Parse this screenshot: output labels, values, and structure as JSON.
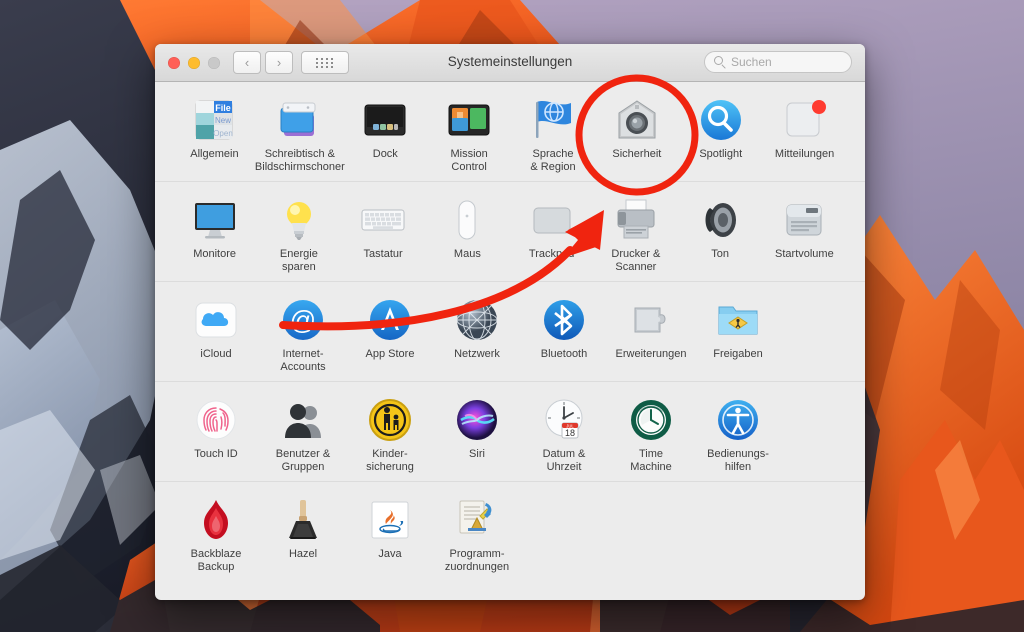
{
  "window": {
    "title": "Systemeinstellungen",
    "traffic_lights": [
      {
        "name": "close",
        "color": "#ff5f57"
      },
      {
        "name": "minimize",
        "color": "#febc2e"
      },
      {
        "name": "zoom",
        "color": "#c9c9c9"
      }
    ],
    "nav": {
      "back": "‹",
      "forward": "›",
      "grid": "show-all-grid"
    },
    "search": {
      "placeholder": "Suchen",
      "value": ""
    }
  },
  "annotation": {
    "color": "#f0240f",
    "circle_target": "Sicherheit",
    "arrow_from": "Internet-Accounts",
    "arrow_to": "Sicherheit"
  },
  "rows": [
    {
      "items": [
        {
          "label": "Allgemein",
          "icon": "general-icon"
        },
        {
          "label": "Schreibtisch &\nBildschirmschoner",
          "icon": "desktop-screensaver-icon"
        },
        {
          "label": "Dock",
          "icon": "dock-icon"
        },
        {
          "label": "Mission\nControl",
          "icon": "mission-control-icon"
        },
        {
          "label": "Sprache\n& Region",
          "icon": "language-region-icon"
        },
        {
          "label": "Sicherheit",
          "icon": "security-icon"
        },
        {
          "label": "Spotlight",
          "icon": "spotlight-icon"
        },
        {
          "label": "Mitteilungen",
          "icon": "notifications-icon"
        }
      ]
    },
    {
      "items": [
        {
          "label": "Monitore",
          "icon": "displays-icon"
        },
        {
          "label": "Energie\nsparen",
          "icon": "energy-saver-icon"
        },
        {
          "label": "Tastatur",
          "icon": "keyboard-icon"
        },
        {
          "label": "Maus",
          "icon": "mouse-icon"
        },
        {
          "label": "Trackpad",
          "icon": "trackpad-icon"
        },
        {
          "label": "Drucker &\nScanner",
          "icon": "printers-scanners-icon"
        },
        {
          "label": "Ton",
          "icon": "sound-icon"
        },
        {
          "label": "Startvolume",
          "icon": "startup-disk-icon"
        }
      ]
    },
    {
      "items": [
        {
          "label": "iCloud",
          "icon": "icloud-icon"
        },
        {
          "label": "Internet-\nAccounts",
          "icon": "internet-accounts-icon"
        },
        {
          "label": "App Store",
          "icon": "app-store-icon"
        },
        {
          "label": "Netzwerk",
          "icon": "network-icon"
        },
        {
          "label": "Bluetooth",
          "icon": "bluetooth-icon"
        },
        {
          "label": "Erweiterungen",
          "icon": "extensions-icon"
        },
        {
          "label": "Freigaben",
          "icon": "sharing-icon"
        }
      ]
    },
    {
      "items": [
        {
          "label": "Touch ID",
          "icon": "touch-id-icon"
        },
        {
          "label": "Benutzer &\nGruppen",
          "icon": "users-groups-icon"
        },
        {
          "label": "Kinder-\nsicherung",
          "icon": "parental-controls-icon"
        },
        {
          "label": "Siri",
          "icon": "siri-icon"
        },
        {
          "label": "Datum &\nUhrzeit",
          "icon": "date-time-icon"
        },
        {
          "label": "Time\nMachine",
          "icon": "time-machine-icon"
        },
        {
          "label": "Bedienungs-\nhilfen",
          "icon": "accessibility-icon"
        }
      ]
    },
    {
      "items": [
        {
          "label": "Backblaze\nBackup",
          "icon": "backblaze-icon"
        },
        {
          "label": "Hazel",
          "icon": "hazel-icon"
        },
        {
          "label": "Java",
          "icon": "java-icon"
        },
        {
          "label": "Programm-\nzuordnungen",
          "icon": "default-apps-icon"
        }
      ]
    }
  ],
  "date_time_icon_text": {
    "month": "JUL",
    "day": "18"
  },
  "general_icon_text": {
    "l1": "File",
    "l2": "New",
    "l3": "Open"
  }
}
